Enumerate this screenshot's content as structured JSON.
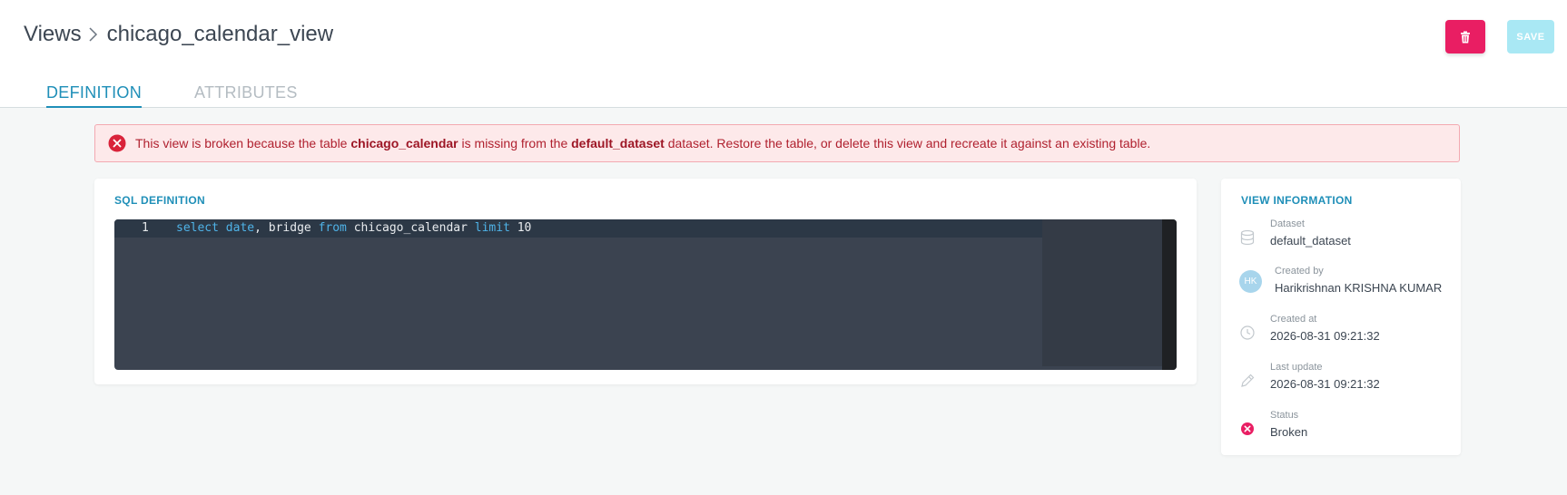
{
  "breadcrumb": {
    "root": "Views",
    "current": "chicago_calendar_view"
  },
  "toolbar": {
    "save_label": "SAVE",
    "delete_icon": "trash-icon"
  },
  "tabs": [
    {
      "label": "DEFINITION",
      "active": true
    },
    {
      "label": "ATTRIBUTES",
      "active": false
    }
  ],
  "alert": {
    "icon": "error-circle-icon",
    "text_1": "This view is broken because the table ",
    "table": "chicago_calendar",
    "text_2": " is missing from the ",
    "dataset": "default_dataset",
    "text_3": " dataset. Restore the table, or delete this view and recreate it against an existing table."
  },
  "sql_card": {
    "title": "SQL DEFINITION",
    "line_number": "1",
    "code_tokens": [
      "select",
      " ",
      "date",
      ", bridge ",
      "from",
      " chicago_calendar ",
      "limit",
      " 10"
    ]
  },
  "info_card": {
    "title": "VIEW INFORMATION",
    "dataset_label": "Dataset",
    "dataset_value": "default_dataset",
    "created_by_label": "Created by",
    "created_by_value": "Harikrishnan KRISHNA KUMAR",
    "created_by_initials": "HK",
    "created_at_label": "Created at",
    "created_at_value": "2026-08-31 09:21:32",
    "last_update_label": "Last update",
    "last_update_value": "2026-08-31 09:21:32",
    "status_label": "Status",
    "status_value": "Broken"
  },
  "colors": {
    "accent": "#1f8fb8",
    "danger": "#e91e63",
    "save_disabled": "#a9e8f4",
    "alert_bg": "#fde9ea",
    "alert_text": "#b0212f",
    "editor_bg": "#3b4350",
    "keyword": "#4fb3e8"
  }
}
